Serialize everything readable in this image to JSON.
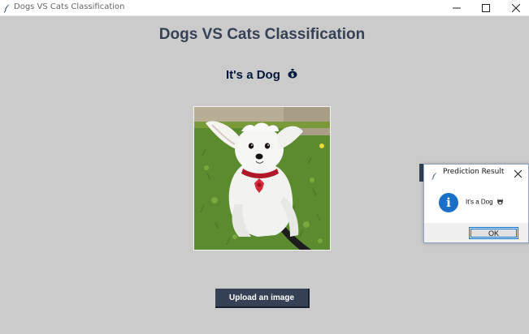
{
  "window": {
    "title": "Dogs VS Cats Classification",
    "controls": [
      "minimize-icon",
      "maximize-icon",
      "close-icon"
    ]
  },
  "main": {
    "heading": "Dogs VS Cats Classification",
    "result_text": "It's a Dog",
    "result_icon": "money-bag-icon",
    "image_icon": "dog-photo",
    "upload_label": "Upload an image"
  },
  "dialog": {
    "title": "Prediction Result",
    "message": "It's a Dog",
    "message_icon": "dog-icon",
    "info_icon": "info-icon",
    "ok_label": "OK"
  },
  "colors": {
    "background": "#cbcbcb",
    "heading": "#364156",
    "result": "#011638",
    "button": "#364156",
    "info": "#1a6fc9",
    "focus": "#0078d7"
  }
}
